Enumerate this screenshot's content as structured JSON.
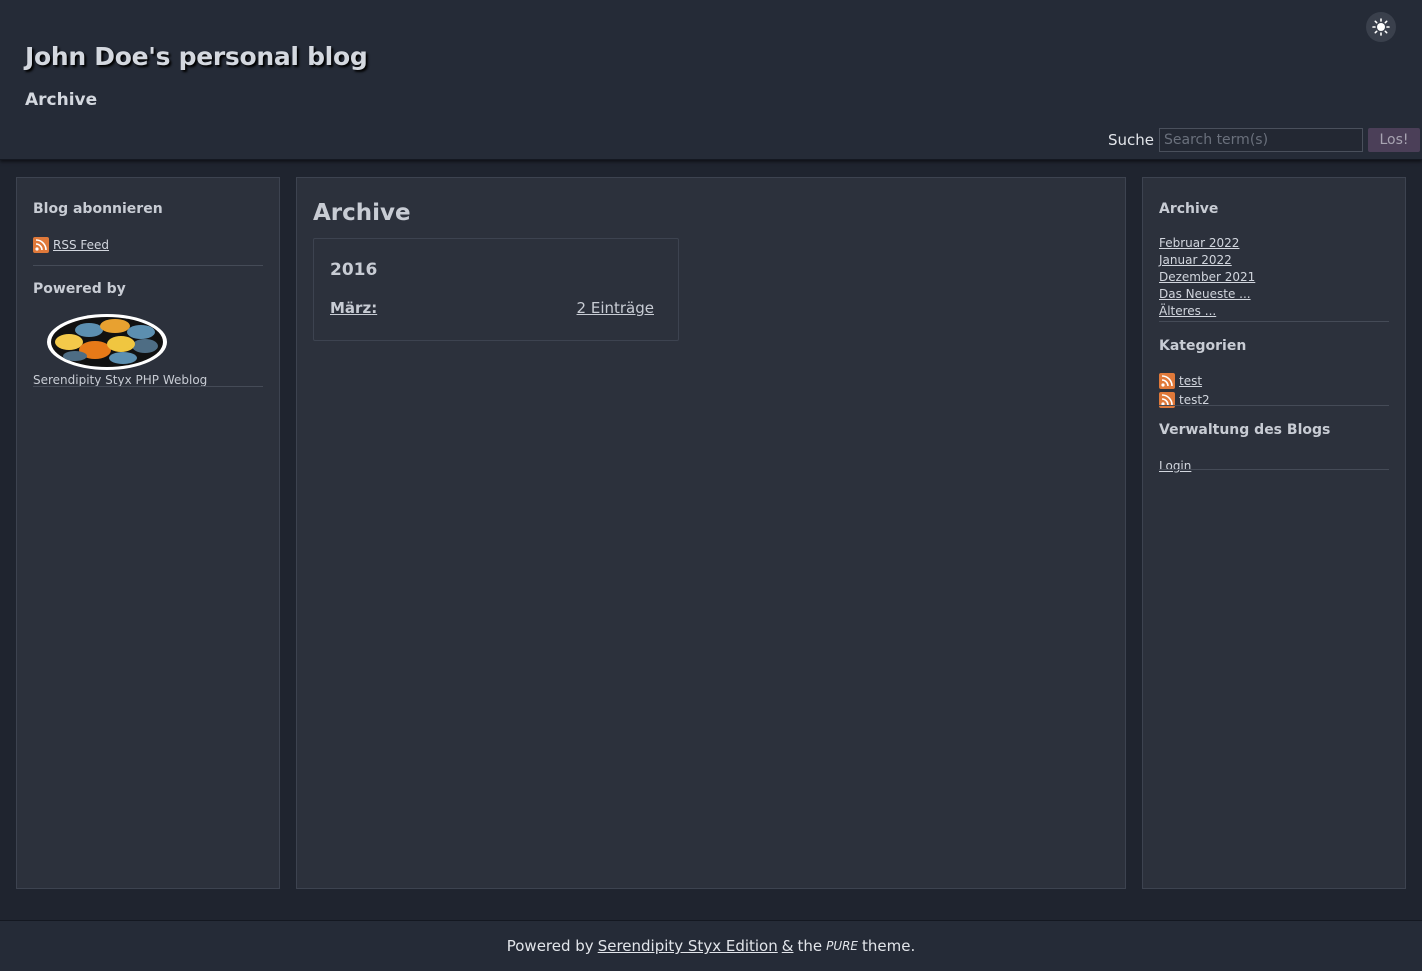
{
  "header": {
    "blog_title": "John Doe's personal blog",
    "page_subtitle": "Archive",
    "theme_toggle_icon": "sun-icon",
    "search": {
      "label": "Suche",
      "placeholder": "Search term(s)",
      "button": "Los!"
    }
  },
  "left_sidebar": {
    "subscribe": {
      "title": "Blog abonnieren",
      "rss_label": "RSS Feed"
    },
    "powered_by": {
      "title": "Powered by",
      "logo_caption": "Serendipity Styx PHP Weblog"
    }
  },
  "main": {
    "title": "Archive",
    "years": [
      {
        "year": "2016",
        "months": [
          {
            "month": "März",
            "count_label": "2 Einträge"
          }
        ]
      }
    ]
  },
  "right_sidebar": {
    "archive": {
      "title": "Archive",
      "links": [
        "Februar 2022",
        "Januar 2022",
        "Dezember 2021",
        "Das Neueste ...",
        "Älteres ..."
      ]
    },
    "categories": {
      "title": "Kategorien",
      "items": [
        "test",
        "test2"
      ]
    },
    "admin": {
      "title": "Verwaltung des Blogs",
      "login": "Login"
    }
  },
  "footer": {
    "prefix": "Powered by",
    "link": "Serendipity Styx Edition",
    "amp": "&",
    "the": "the",
    "theme_name": "PURE",
    "suffix": "theme."
  },
  "colors": {
    "background": "#1f242f",
    "panel": "#2c313c",
    "rss": "#e0793a",
    "button": "#4b3f58"
  }
}
